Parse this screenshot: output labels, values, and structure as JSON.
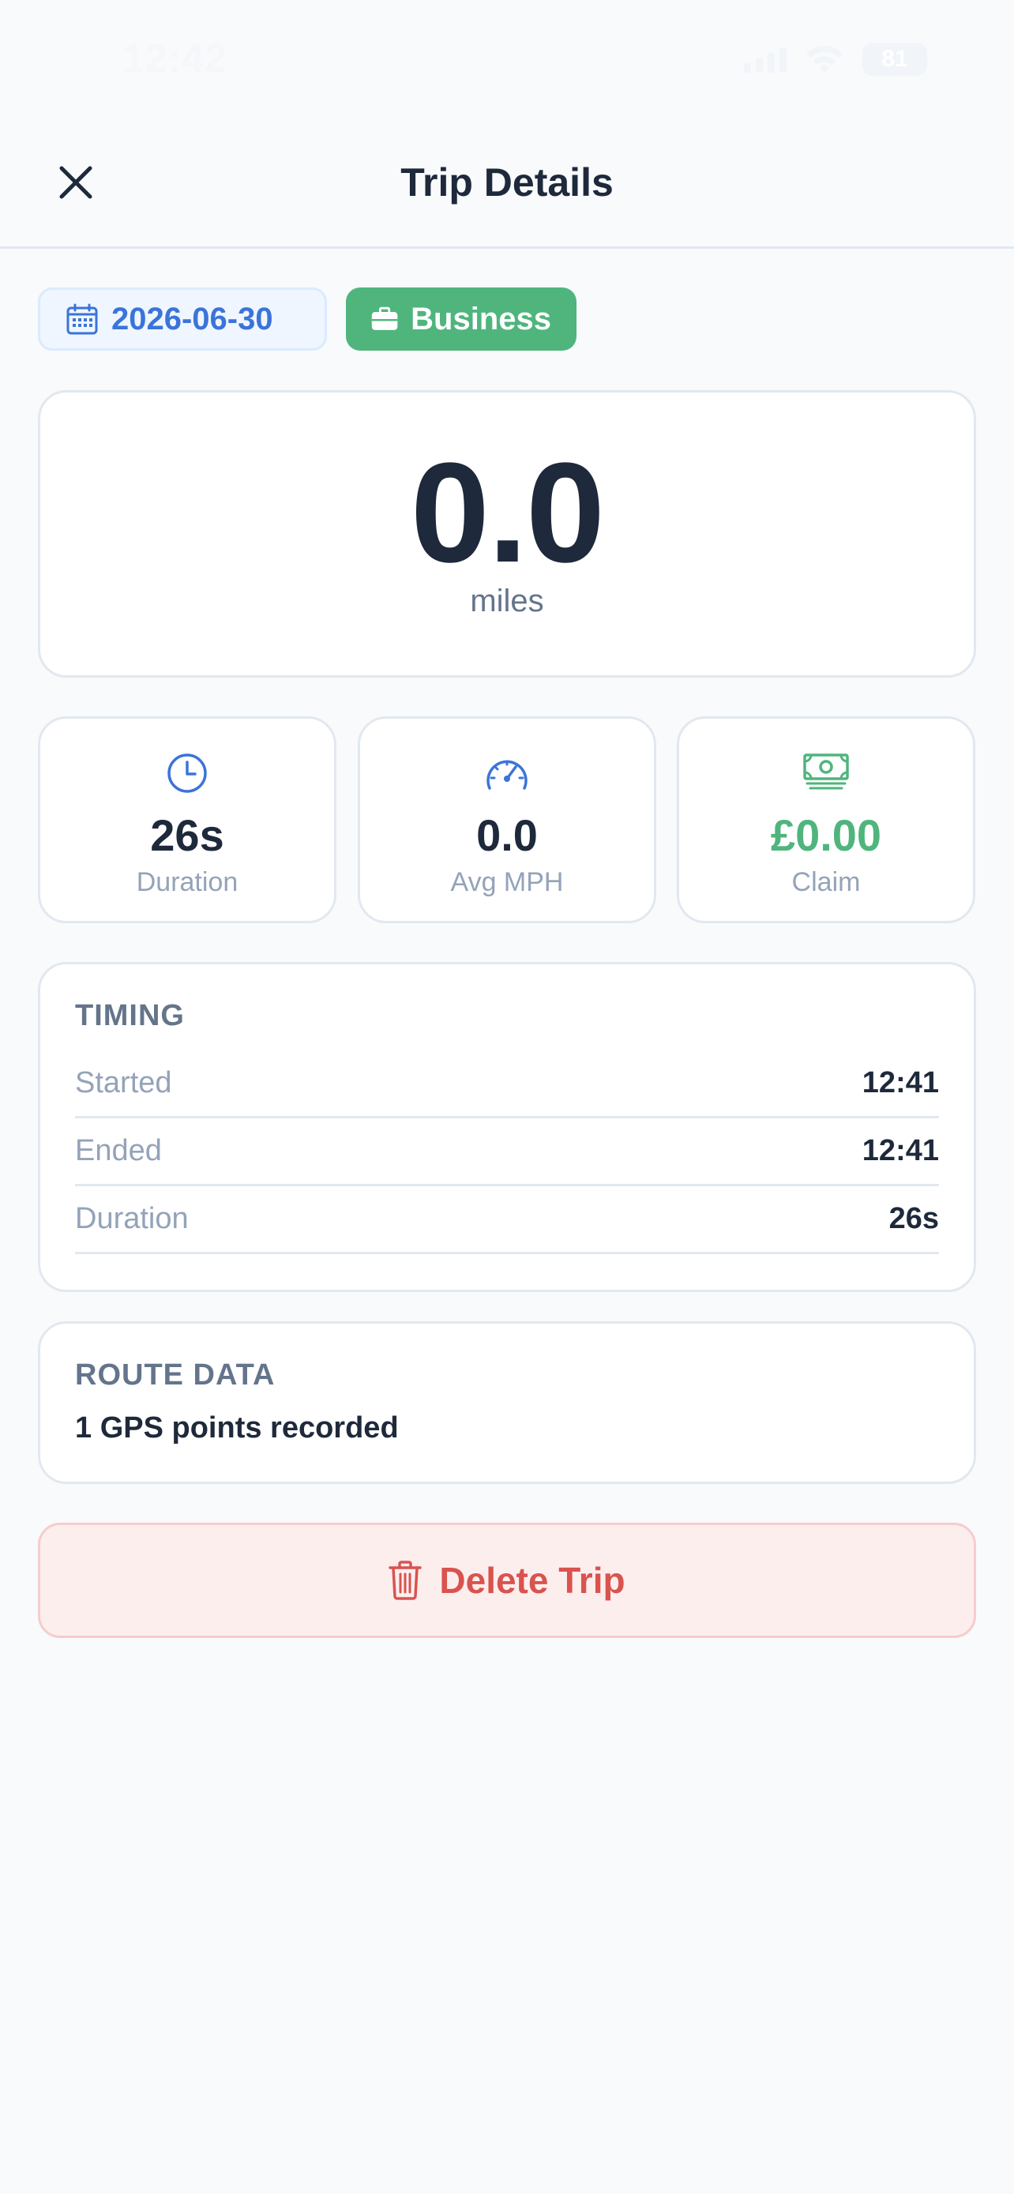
{
  "status_bar": {
    "time": "12:42",
    "battery": "81"
  },
  "header": {
    "title": "Trip Details",
    "close_icon": "close-icon"
  },
  "tags": {
    "date": "2026-06-30",
    "category": "Business"
  },
  "distance": {
    "value": "0.0",
    "unit": "miles"
  },
  "stats": [
    {
      "icon": "clock-icon",
      "value": "26s",
      "label": "Duration"
    },
    {
      "icon": "speedometer-icon",
      "value": "0.0",
      "label": "Avg MPH"
    },
    {
      "icon": "money-icon",
      "value": "£0.00",
      "label": "Claim"
    }
  ],
  "timing": {
    "title": "TIMING",
    "rows": [
      {
        "label": "Started",
        "value": "12:41"
      },
      {
        "label": "Ended",
        "value": "12:41"
      },
      {
        "label": "Duration",
        "value": "26s"
      }
    ]
  },
  "route": {
    "title": "ROUTE DATA",
    "text": "1 GPS points recorded"
  },
  "actions": {
    "delete_label": "Delete Trip"
  },
  "colors": {
    "primary_blue": "#3b74d9",
    "business_green": "#4fb57d",
    "danger_red": "#d9534f",
    "text_dark": "#1e293b",
    "text_muted": "#94a3b8"
  }
}
